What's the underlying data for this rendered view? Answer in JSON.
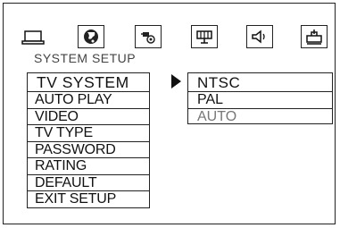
{
  "toolbar": {
    "tabs": [
      {
        "icon": "system-setup-icon"
      },
      {
        "icon": "language-icon"
      },
      {
        "icon": "audio-setup-icon"
      },
      {
        "icon": "video-setup-icon"
      },
      {
        "icon": "speaker-icon"
      },
      {
        "icon": "digital-setup-icon"
      }
    ]
  },
  "page": {
    "caption": "SYSTEM  SETUP"
  },
  "menu": {
    "items": [
      {
        "label": "TV SYSTEM"
      },
      {
        "label": "AUTO  PLAY"
      },
      {
        "label": "VIDEO"
      },
      {
        "label": "TV TYPE"
      },
      {
        "label": "PASSWORD"
      },
      {
        "label": "RATING"
      },
      {
        "label": "DEFAULT"
      },
      {
        "label": "EXIT SETUP"
      }
    ],
    "selected_index": 0
  },
  "submenu": {
    "options": [
      {
        "label": "NTSC"
      },
      {
        "label": "PAL"
      },
      {
        "label": "AUTO",
        "disabled": true
      }
    ],
    "highlighted_index": 0
  }
}
